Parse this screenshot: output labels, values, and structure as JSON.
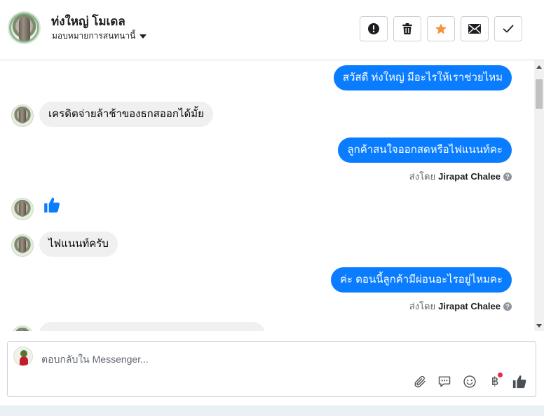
{
  "header": {
    "contact_name": "ท่งใหญ่ โมเดล",
    "assign_label": "มอบหมายการสนทนานี้",
    "icons": {
      "avatar": "contact-avatar",
      "report": "exclamation-icon",
      "delete": "trash-icon",
      "star": "star-icon",
      "mail": "envelope-icon",
      "done": "check-icon"
    }
  },
  "messages": [
    {
      "dir": "out",
      "text": "สวัสดี ท่งใหญ่ มีอะไรให้เราช่วยไหม"
    },
    {
      "dir": "in",
      "text": "เครดิตจ่ายล้าช้าของธกสออกได้มั้ย"
    },
    {
      "dir": "out",
      "text": "ลูกค้าสนใจออกสดหรือไฟแนนท์คะ",
      "sent_by_prefix": "ส่งโดย",
      "sent_by_name": "Jirapat Chalee"
    },
    {
      "dir": "in",
      "type": "like",
      "icon": "thumbs-up-icon"
    },
    {
      "dir": "in",
      "text": "ไฟแนนท์ครับ"
    },
    {
      "dir": "out",
      "text": "ค่ะ ดอนนี้ลูกค้ามีผ่อนอะไรอยู่ไหมคะ",
      "sent_by_prefix": "ส่งโดย",
      "sent_by_name": "Jirapat Chalee"
    }
  ],
  "composer": {
    "placeholder": "ตอบกลับใน Messenger...",
    "tools": [
      "paperclip-icon",
      "chat-bubble-icon",
      "smiley-icon",
      "baht-icon",
      "thumbs-up-icon"
    ],
    "baht_symbol": "฿"
  },
  "colors": {
    "outgoing_bubble": "#0a7cff",
    "incoming_bubble": "#f0f0f0",
    "star": "#f5923e",
    "notification_dot": "#f02849"
  }
}
